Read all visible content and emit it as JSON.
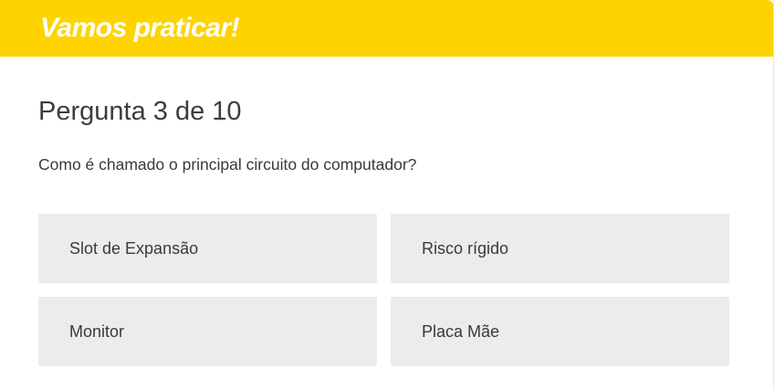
{
  "banner": {
    "title": "Vamos praticar!",
    "color": "#fdd400"
  },
  "quiz": {
    "counter": "Pergunta 3 de 10",
    "question": "Como é chamado o principal circuito do computador?",
    "answers": [
      {
        "label": "Slot de Expansão"
      },
      {
        "label": "Risco rígido"
      },
      {
        "label": "Monitor"
      },
      {
        "label": "Placa Mãe"
      }
    ]
  },
  "colors": {
    "answer_background": "#ececec",
    "text": "#3a3a3a"
  }
}
